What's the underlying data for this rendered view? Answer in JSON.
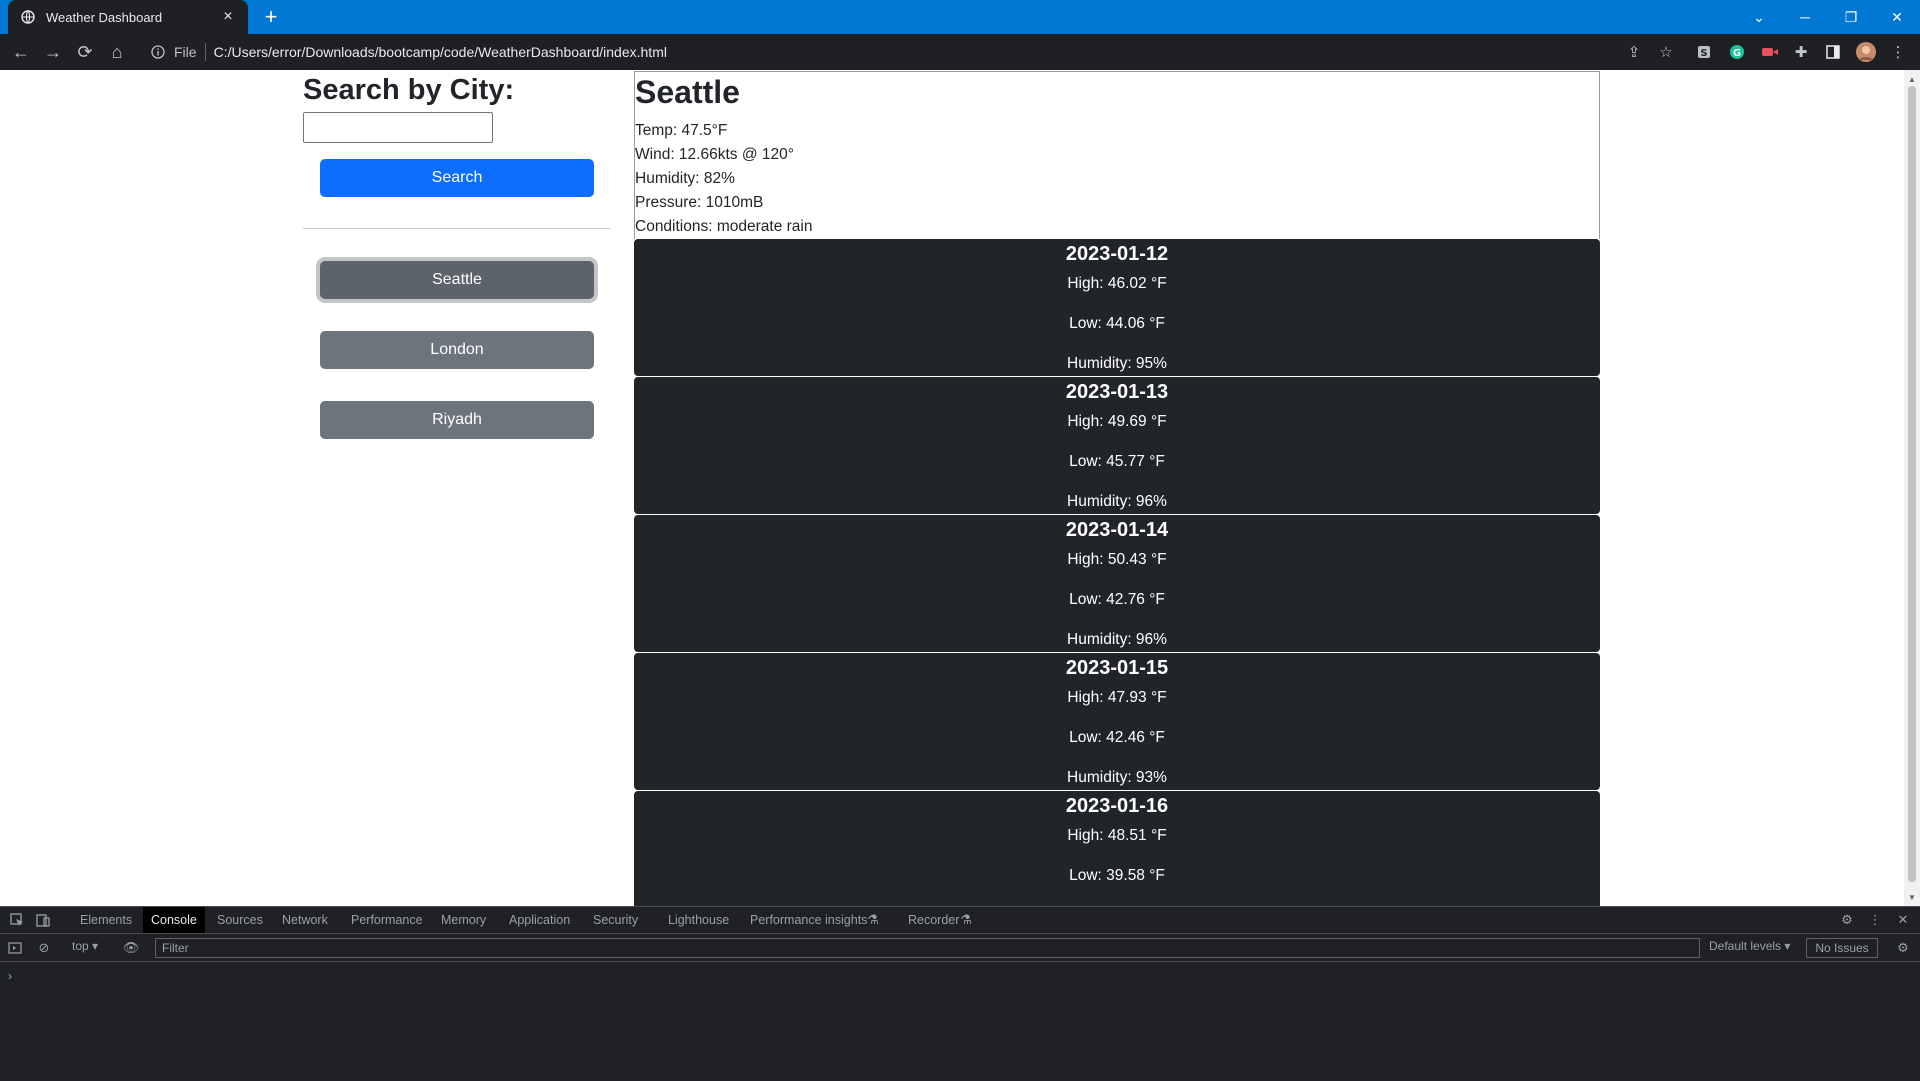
{
  "browser": {
    "tab_title": "Weather Dashboard",
    "address_label": "File",
    "url": "C:/Users/error/Downloads/bootcamp/code/WeatherDashboard/index.html"
  },
  "sidebar": {
    "heading": "Search by City:",
    "input_value": "",
    "search_label": "Search",
    "history": [
      {
        "label": "Seattle"
      },
      {
        "label": "London"
      },
      {
        "label": "Riyadh"
      }
    ]
  },
  "current": {
    "city": "Seattle",
    "temp": "Temp: 47.5°F",
    "wind": "Wind: 12.66kts @ 120°",
    "humidity": "Humidity: 82%",
    "pressure": "Pressure: 1010mB",
    "conditions": "Conditions: moderate rain"
  },
  "forecast": [
    {
      "date": "2023-01-12",
      "high": "High: 46.02 °F",
      "low": "Low: 44.06 °F",
      "humidity": "Humidity: 95%"
    },
    {
      "date": "2023-01-13",
      "high": "High: 49.69 °F",
      "low": "Low: 45.77 °F",
      "humidity": "Humidity: 96%"
    },
    {
      "date": "2023-01-14",
      "high": "High: 50.43 °F",
      "low": "Low: 42.76 °F",
      "humidity": "Humidity: 96%"
    },
    {
      "date": "2023-01-15",
      "high": "High: 47.93 °F",
      "low": "Low: 42.46 °F",
      "humidity": "Humidity: 93%"
    },
    {
      "date": "2023-01-16",
      "high": "High: 48.51 °F",
      "low": "Low: 39.58 °F",
      "humidity": ""
    }
  ],
  "devtools": {
    "tabs": [
      "Elements",
      "Console",
      "Sources",
      "Network",
      "Performance",
      "Memory",
      "Application",
      "Security",
      "Lighthouse",
      "Performance insights",
      "Recorder"
    ],
    "active_tab": "Console",
    "context": "top",
    "filter_placeholder": "Filter",
    "levels": "Default levels",
    "issues": "No Issues",
    "prompt": "›"
  },
  "colors": {
    "tabbar": "#0078d4",
    "primary_button": "#0d6efd",
    "secondary_button": "#6c757d",
    "forecast_card": "#212529"
  }
}
